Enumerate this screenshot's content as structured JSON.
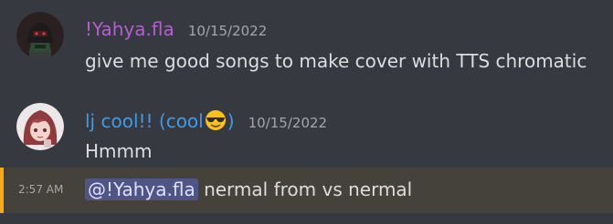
{
  "messages": [
    {
      "author": "!Yahya.fla",
      "author_color": "#b160cf",
      "timestamp": "10/15/2022",
      "text": "give me good songs to make cover with TTS chromatic",
      "avatar_icon": "dark-hooded-character-avatar"
    },
    {
      "author": "lj cool!! (cool",
      "author_suffix": ")",
      "author_color": "#3f9be8",
      "author_emoji": "smiling-face-with-sunglasses",
      "timestamp": "10/15/2022",
      "text": "Hmmm",
      "avatar_icon": "anime-girl-avatar"
    },
    {
      "side_time": "2:57 AM",
      "mention": "@!Yahya.fla",
      "text": " nermal from vs nermal",
      "highlight_color": "#45423b",
      "bar_color": "#faa81a"
    }
  ],
  "colors": {
    "background": "#36393f",
    "text": "#dcddde",
    "muted": "#a3a6aa",
    "mention_bg": "#4f5584"
  }
}
